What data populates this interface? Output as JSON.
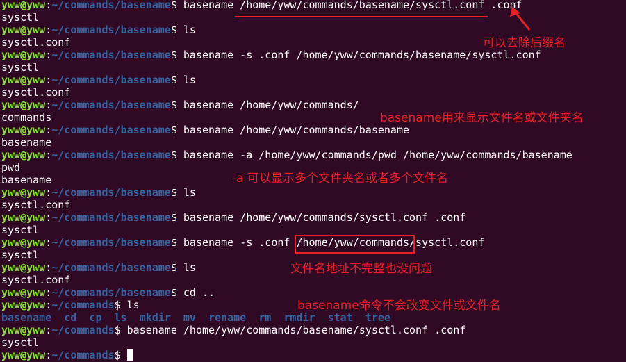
{
  "prompt": {
    "user": "yww@yww",
    "colon": ":",
    "path_basename": "~/commands/basename",
    "path_commands": "~/commands",
    "dollar": "$ "
  },
  "lines": [
    {
      "type": "prompt",
      "path": "path_basename",
      "cmd": "basename /home/yww/commands/basename/sysctl.conf .conf"
    },
    {
      "type": "out",
      "text": "sysctl"
    },
    {
      "type": "prompt",
      "path": "path_basename",
      "cmd": "ls"
    },
    {
      "type": "out",
      "text": "sysctl.conf"
    },
    {
      "type": "prompt",
      "path": "path_basename",
      "cmd": "basename -s .conf /home/yww/commands/basename/sysctl.conf"
    },
    {
      "type": "out",
      "text": "sysctl"
    },
    {
      "type": "prompt",
      "path": "path_basename",
      "cmd": "ls"
    },
    {
      "type": "out",
      "text": "sysctl.conf"
    },
    {
      "type": "prompt",
      "path": "path_basename",
      "cmd": "basename /home/yww/commands/"
    },
    {
      "type": "out",
      "text": "commands"
    },
    {
      "type": "prompt",
      "path": "path_basename",
      "cmd": "basename /home/yww/commands/basename"
    },
    {
      "type": "out",
      "text": "basename"
    },
    {
      "type": "prompt",
      "path": "path_basename",
      "cmd": "basename -a /home/yww/commands/pwd /home/yww/commands/basename"
    },
    {
      "type": "out",
      "text": "pwd"
    },
    {
      "type": "out",
      "text": "basename"
    },
    {
      "type": "prompt",
      "path": "path_basename",
      "cmd": "ls"
    },
    {
      "type": "out",
      "text": "sysctl.conf"
    },
    {
      "type": "prompt",
      "path": "path_basename",
      "cmd": "basename /home/yww/commands/sysctl.conf .conf"
    },
    {
      "type": "out",
      "text": "sysctl"
    },
    {
      "type": "prompt",
      "path": "path_basename",
      "cmd": "basename -s .conf /home/yww/commands/sysctl.conf"
    },
    {
      "type": "out",
      "text": "sysctl"
    },
    {
      "type": "prompt",
      "path": "path_basename",
      "cmd": "ls"
    },
    {
      "type": "out",
      "text": "sysctl.conf"
    },
    {
      "type": "prompt",
      "path": "path_basename",
      "cmd": "cd .."
    },
    {
      "type": "prompt",
      "path": "path_commands",
      "cmd": "ls"
    },
    {
      "type": "dirs",
      "text": "basename  cd  cp  ls  mkdir  mv  rename  rm  rmdir  stat  tree"
    },
    {
      "type": "prompt",
      "path": "path_commands",
      "cmd": "basename /home/yww/commands/basename/sysctl.conf .conf"
    },
    {
      "type": "out",
      "text": "sysctl"
    },
    {
      "type": "prompt",
      "path": "path_commands",
      "cmd": "",
      "cursor": true
    }
  ],
  "annotations": {
    "remove_suffix": "可以去除后缀名",
    "show_name": "basename用来显示文件名或文件夹名",
    "multi": "-a 可以显示多个文件夹名或者多个文件名",
    "incomplete_path": "文件名地址不完整也没问题",
    "no_change": "basename命令不会改变文件或文件名"
  },
  "colors": {
    "background": "#300a24",
    "user": "#8ae234",
    "path": "#3465a4",
    "annotation": "#e8202a"
  }
}
